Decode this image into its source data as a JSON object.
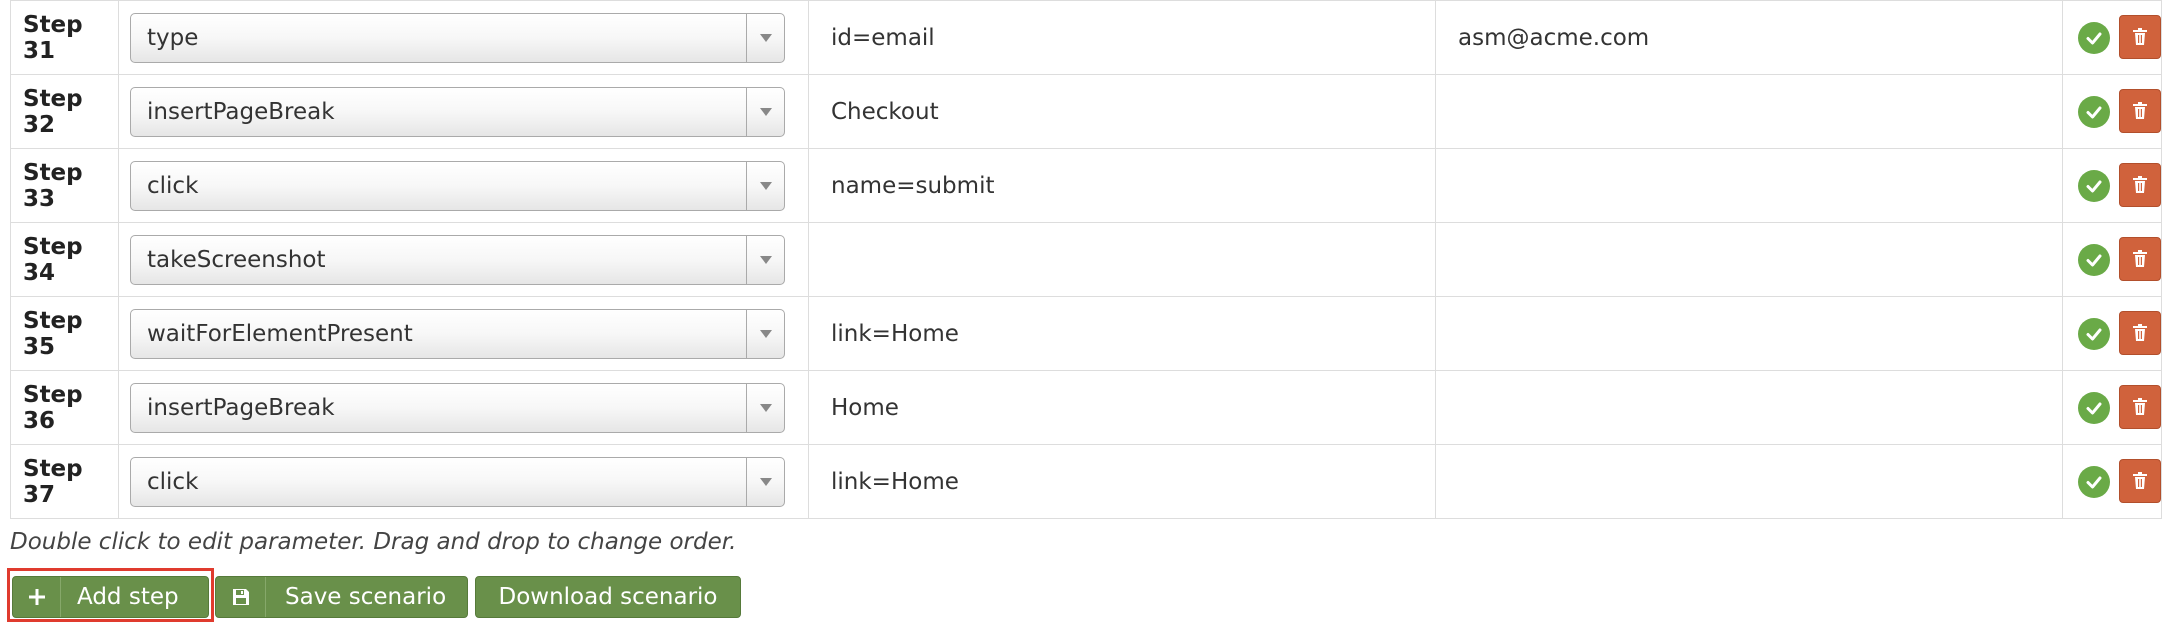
{
  "steps": [
    {
      "label": "Step 31",
      "command": "type",
      "target": "id=email",
      "value": "asm@acme.com"
    },
    {
      "label": "Step 32",
      "command": "insertPageBreak",
      "target": "Checkout",
      "value": ""
    },
    {
      "label": "Step 33",
      "command": "click",
      "target": "name=submit",
      "value": ""
    },
    {
      "label": "Step 34",
      "command": "takeScreenshot",
      "target": "",
      "value": ""
    },
    {
      "label": "Step 35",
      "command": "waitForElementPresent",
      "target": "link=Home",
      "value": ""
    },
    {
      "label": "Step 36",
      "command": "insertPageBreak",
      "target": "Home",
      "value": ""
    },
    {
      "label": "Step 37",
      "command": "click",
      "target": "link=Home",
      "value": ""
    }
  ],
  "hint": "Double click to edit parameter. Drag and drop to change order.",
  "buttons": {
    "add_step": "Add step",
    "save_scenario": "Save scenario",
    "download_scenario": "Download scenario"
  },
  "icons": {
    "confirm": "check-circle-icon",
    "delete": "trash-icon",
    "dropdown": "chevron-down-icon",
    "add": "plus-icon",
    "save": "floppy-disk-icon"
  },
  "colors": {
    "button_green": "#69904a",
    "check_green": "#6aaa47",
    "delete_orange": "#d0623c",
    "highlight_red": "#e03b2e"
  }
}
